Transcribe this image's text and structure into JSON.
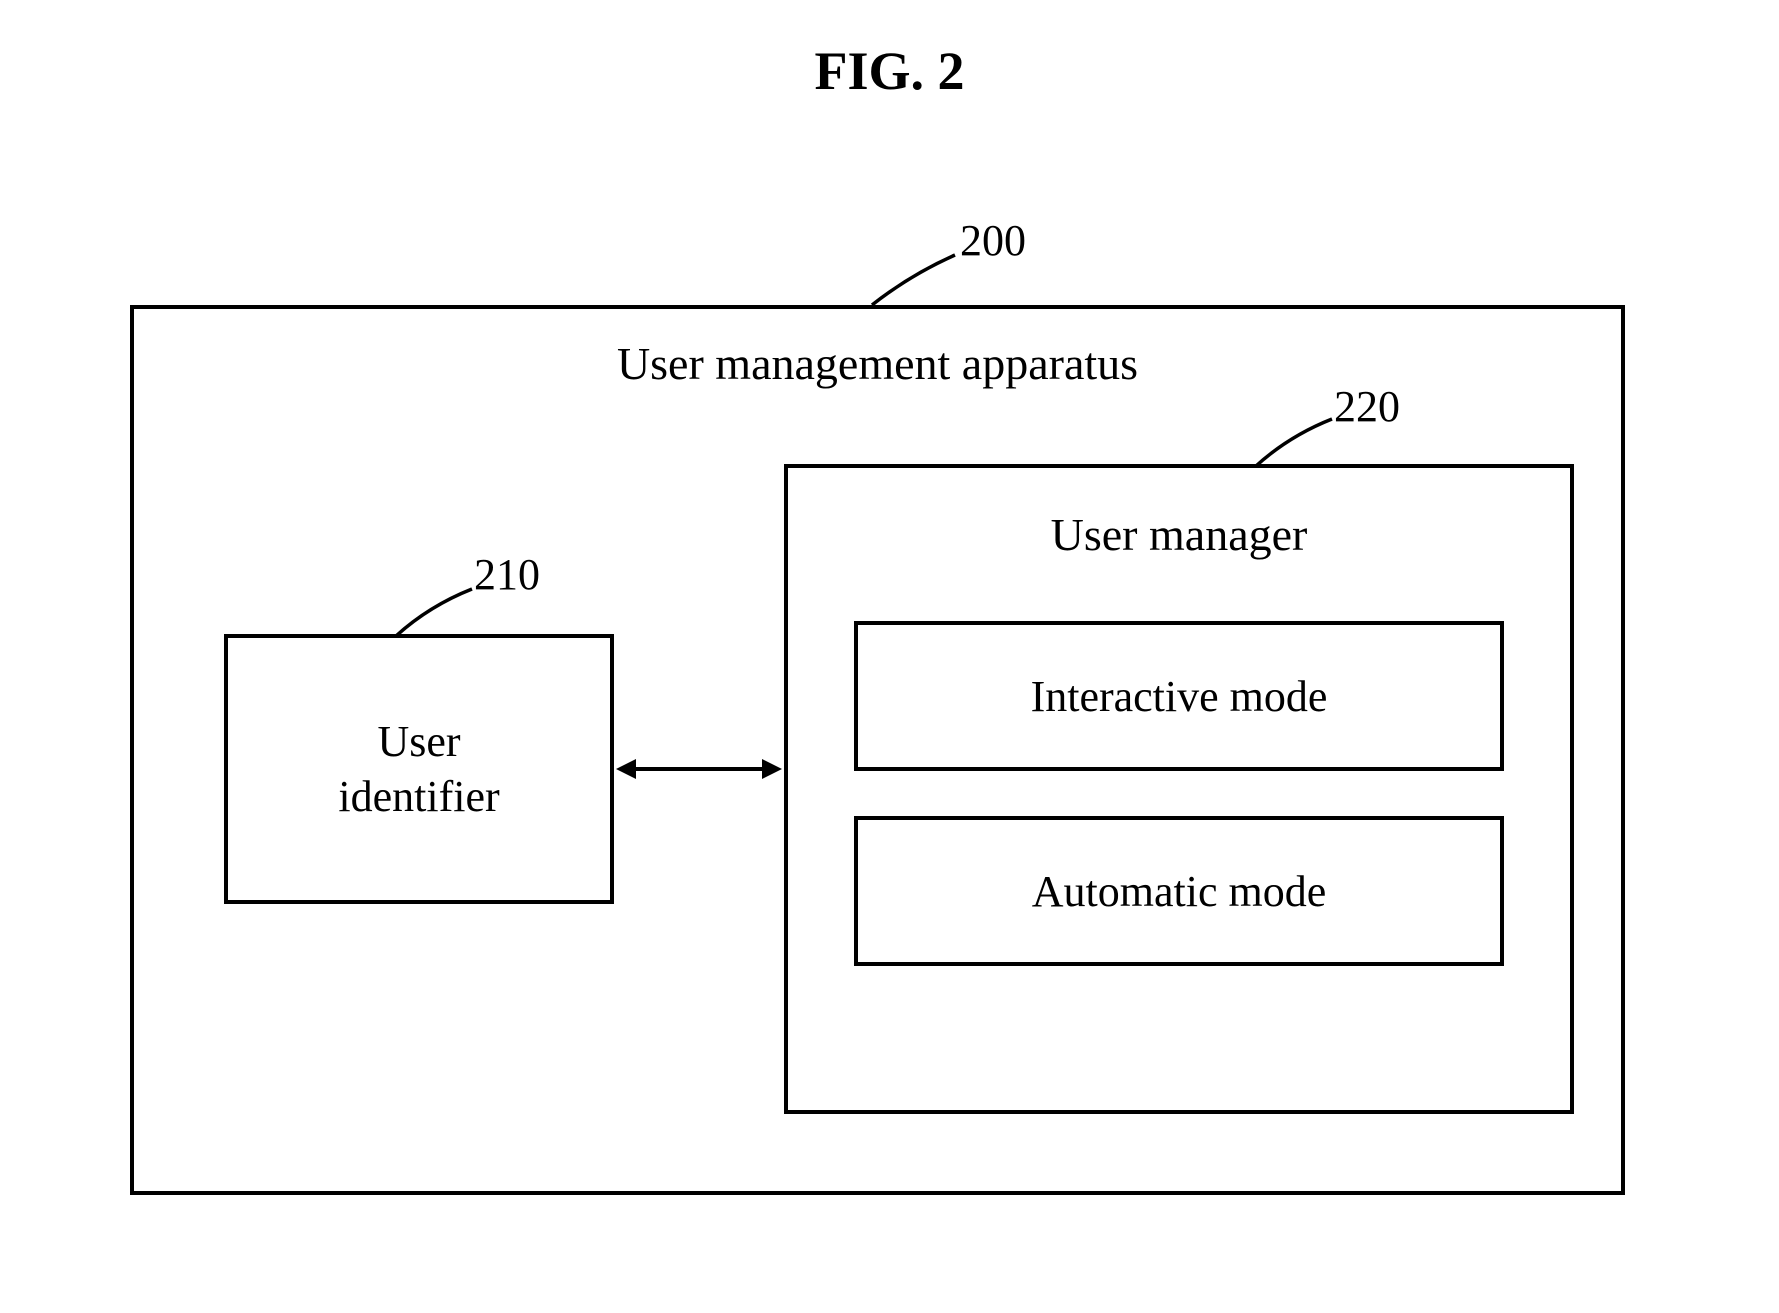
{
  "figure": {
    "title": "FIG. 2"
  },
  "refs": {
    "outer": "200",
    "identifier": "210",
    "manager": "220"
  },
  "labels": {
    "apparatus": "User management apparatus",
    "identifier_line1": "User",
    "identifier_line2": "identifier",
    "manager": "User manager",
    "mode_interactive": "Interactive mode",
    "mode_automatic": "Automatic mode"
  }
}
